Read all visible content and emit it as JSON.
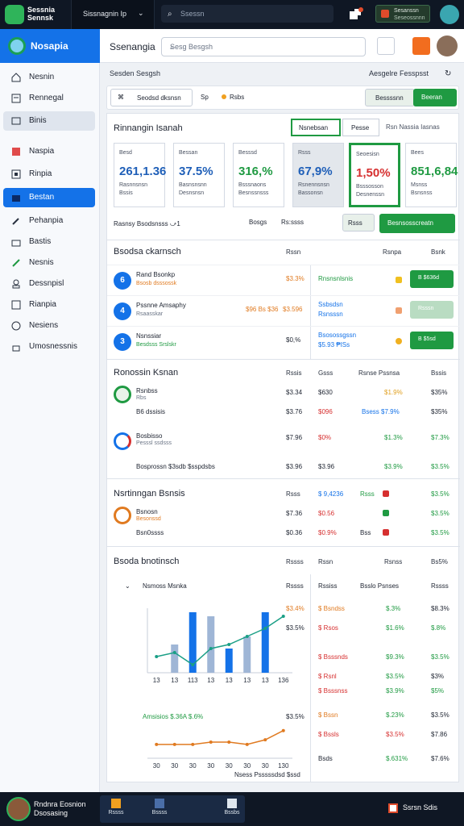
{
  "topbar": {
    "brand_line1": "Sessnia",
    "brand_line2": "Sennsk",
    "account": "Sissnagnin Ip",
    "search_placeholder": "Ssessn",
    "notif_line1": "Sesanssn",
    "notif_line2": "Seseossnnn"
  },
  "sidebar": {
    "header": "Nosapia",
    "items": [
      {
        "label": "Nesnin",
        "icon": "home-icon"
      },
      {
        "label": "Rennegal",
        "icon": "report-icon"
      },
      {
        "label": "Binis",
        "icon": "layers-icon"
      },
      {
        "label": "Naspia",
        "icon": "chart-icon"
      },
      {
        "label": "Rinpia",
        "icon": "box-icon"
      },
      {
        "label": "Bestan",
        "icon": "folder-icon"
      },
      {
        "label": "Pehanpia",
        "icon": "pen-icon"
      },
      {
        "label": "Bastis",
        "icon": "bag-icon"
      },
      {
        "label": "Nesnis",
        "icon": "link-icon"
      },
      {
        "label": "Dessnpisl",
        "icon": "users-icon"
      },
      {
        "label": "Rianpia",
        "icon": "doc-icon"
      },
      {
        "label": "Nesiens",
        "icon": "globe-icon"
      },
      {
        "label": "Umosnessnis",
        "icon": "lock-icon"
      }
    ]
  },
  "header": {
    "title": "Ssenangia",
    "search_placeholder": "Sesg Besgsh"
  },
  "breadcrumb": {
    "left": "Sesden Sesgsh",
    "right": "Aesgelre Fesspsst"
  },
  "toolbar": {
    "chip": "Seodsd dksnsn",
    "sp": "Sp",
    "rs": "Rsbs",
    "outline": "Bessssnn",
    "primary": "Beeran"
  },
  "panel": {
    "title": "Rinnangin Isanah",
    "tab1": "Nsnebsan",
    "tab2": "Pesse",
    "tab3": "Rsn Nassia Iasnas",
    "cards": [
      {
        "label": "Besd",
        "value": "261,1.36",
        "sub1": "Rasnnsnsn",
        "sub2": "Bssis",
        "color": "#1f5fb8"
      },
      {
        "label": "Bessan",
        "value": "37.5%",
        "sub1": "Basnsnsnn",
        "sub2": "Desnsnsn",
        "color": "#1f5fb8"
      },
      {
        "label": "Besssd",
        "value": "316,%",
        "sub1": "Bsssnaons",
        "sub2": "Besnssnsss",
        "color": "#1f9a42"
      },
      {
        "label": "Rsss",
        "value": "67,9%",
        "sub1": "Rsnennsnsn",
        "sub2": "Bassonsn",
        "color": "#1f5fb8"
      },
      {
        "label": "Seoesisn",
        "value": "1,50%",
        "sub1": "Bsssosson",
        "sub2": "Desnenssn",
        "color": "#d62f2f"
      },
      {
        "label": "Bees",
        "value": "851,6,84",
        "sub1": "Msnss",
        "sub2": "Bsnsnss",
        "color": "#1f9a42"
      }
    ],
    "filter_label": "Rasnsy Bsodsnsss ⤻1",
    "filter_sel1": "Bosgs",
    "filter_sel2": "Rs:ssss",
    "filter_btn": "Rsss",
    "filter_primary": "Besnsosscreatn"
  },
  "sec1": {
    "title": "Bsodsa ckarnsch",
    "col1": "Rssn",
    "col2": "Rsnpa",
    "col3": "Bsnk",
    "rows": [
      {
        "n": "6",
        "t1": "Rand Bsonkp",
        "t2": "Bsosb dsssossk",
        "v": "$3.3%",
        "r": "Rnsnsnlsnis",
        "btn": "B $636d",
        "disabled": false,
        "sq": "#f0c020",
        "c": "#1472e8"
      },
      {
        "n": "4",
        "t1": "Pssnne Amsaphy",
        "t2": "Rsaasskar",
        "tag": "$96 Bs $36",
        "v": "$3.596",
        "r": "Ssbsdsn",
        "r2": "Rsnsssn",
        "btn": "Rsssn",
        "disabled": true,
        "sq": "#f0a070",
        "c": "#1472e8"
      },
      {
        "n": "3",
        "t1": "Nsnssiar",
        "t2": "Besdsss Srslskr",
        "v": "$0,%",
        "r": "Bsosossgssn",
        "r2": "$5.93 ₱ISs",
        "btn": "B $5sd",
        "disabled": false,
        "sq": "#f0b020",
        "c": "#1472e8"
      }
    ]
  },
  "sec2": {
    "title": "Ronossin Ksnan",
    "col1": "Rssis",
    "col2": "Gsss",
    "col3": "Rsnse Pssnsa",
    "col4": "Bssis",
    "rows": [
      {
        "t1": "Rsnbss",
        "t2": "Rbs",
        "v": "$3.34",
        "g": "$630",
        "p": "$1.9%",
        "b": "$35%"
      },
      {
        "t1": "B6 dssisis",
        "t2": "",
        "v": "$3.76",
        "g": "$096",
        "p": "Bsess $7.9%",
        "b": "$35%"
      },
      {
        "t1": "Bosbisso",
        "t2": "Pesssl ssdsss",
        "v": "$7.96",
        "g": "$0%",
        "p": "$1.3%",
        "b": "$7.3%"
      },
      {
        "t1": "Bosprossn $3sdb $sspdsbs",
        "t2": "",
        "v": "$3.96",
        "g": "$3.96",
        "p": "$3.9%",
        "b": "$3.5%"
      }
    ]
  },
  "sec3": {
    "title": "Nsrtinngan Bsnsis",
    "col1": "Rsss",
    "col2": "$ 9,4236",
    "col3": "Rsss",
    "col4": "$3.5%",
    "rows": [
      {
        "t1": "Bsnosn",
        "t2": "Besonssd",
        "v": "$7.36",
        "g": "$0.56",
        "p": "Bss",
        "b": "$3.5%"
      },
      {
        "t1": "Bsn0ssss",
        "t2": "",
        "v": "$0.36",
        "g": "$0.9%",
        "p": "Bss",
        "b": "$3.5%"
      }
    ]
  },
  "sec4": {
    "title": "Bsoda bnotinsch",
    "col1": "Rssss",
    "col2": "Rssn",
    "col3": "Rsnss",
    "col4": "Bs5%",
    "sub_title": "Nsmoss Msnka",
    "sub_c1": "Rssss",
    "sub_c2": "Rssiss",
    "sub_c3": "Bsslo Psnses",
    "sub_c4": "Rssss",
    "list": [
      {
        "a": "$ Bsndss",
        "b": "$.3%",
        "c": "$8.3%"
      },
      {
        "a": "$ Rsos",
        "b": "$1.6%",
        "c": "$.8%"
      },
      {
        "a": "$ Bsssnds",
        "b": "$9.3%",
        "c": "$3.5%"
      },
      {
        "a": "$ Rsnl",
        "b": "$3.5%",
        "c": "$3%"
      },
      {
        "a": "$ Bsssnss",
        "b": "$3.9%",
        "c": "$5%"
      },
      {
        "a": "$ Bssn",
        "b": "$.23%",
        "c": "$3.5%"
      },
      {
        "a": "$ Bssls",
        "b": "$3.5%",
        "c": "$7.86"
      },
      {
        "a": "Bsds",
        "b": "$.631%",
        "c": "$7.6%"
      }
    ],
    "chart1_label": "$3.4%",
    "chart1_label2": "$3.5%",
    "chart2_title": "Amsisios $.36A $.6%",
    "chart2_label": "$3.5%",
    "x_ticks": [
      "13",
      "13",
      "113",
      "13",
      "13",
      "13",
      "13",
      "136"
    ],
    "x_ticks2": [
      "30",
      "30",
      "30",
      "30",
      "30",
      "30",
      "30",
      "130"
    ],
    "axis_caption": "Nsess Psssssdsd $ssd"
  },
  "bottom": {
    "line1": "Rndnra Eosnion",
    "line2": "Dsosasing",
    "dock": [
      "Rssss",
      "Bssss",
      "Bssbs"
    ],
    "status": "Ssrsn Sdis"
  },
  "chart_data": [
    {
      "type": "bar",
      "categories": [
        "13",
        "13",
        "113",
        "13",
        "13",
        "13",
        "13",
        "136"
      ],
      "series": [
        {
          "values": [
            0,
            14,
            30,
            28,
            12,
            18,
            30,
            0
          ]
        }
      ]
    },
    {
      "type": "line",
      "x": [
        "13",
        "13",
        "113",
        "13",
        "13",
        "13",
        "13",
        "136"
      ],
      "series": [
        {
          "values": [
            8,
            10,
            4,
            12,
            14,
            18,
            22,
            28
          ]
        }
      ]
    },
    {
      "type": "line",
      "x": [
        "30",
        "30",
        "30",
        "30",
        "30",
        "30",
        "30",
        "130"
      ],
      "series": [
        {
          "values": [
            6,
            6,
            6,
            7,
            7,
            6,
            8,
            12
          ]
        }
      ]
    }
  ]
}
